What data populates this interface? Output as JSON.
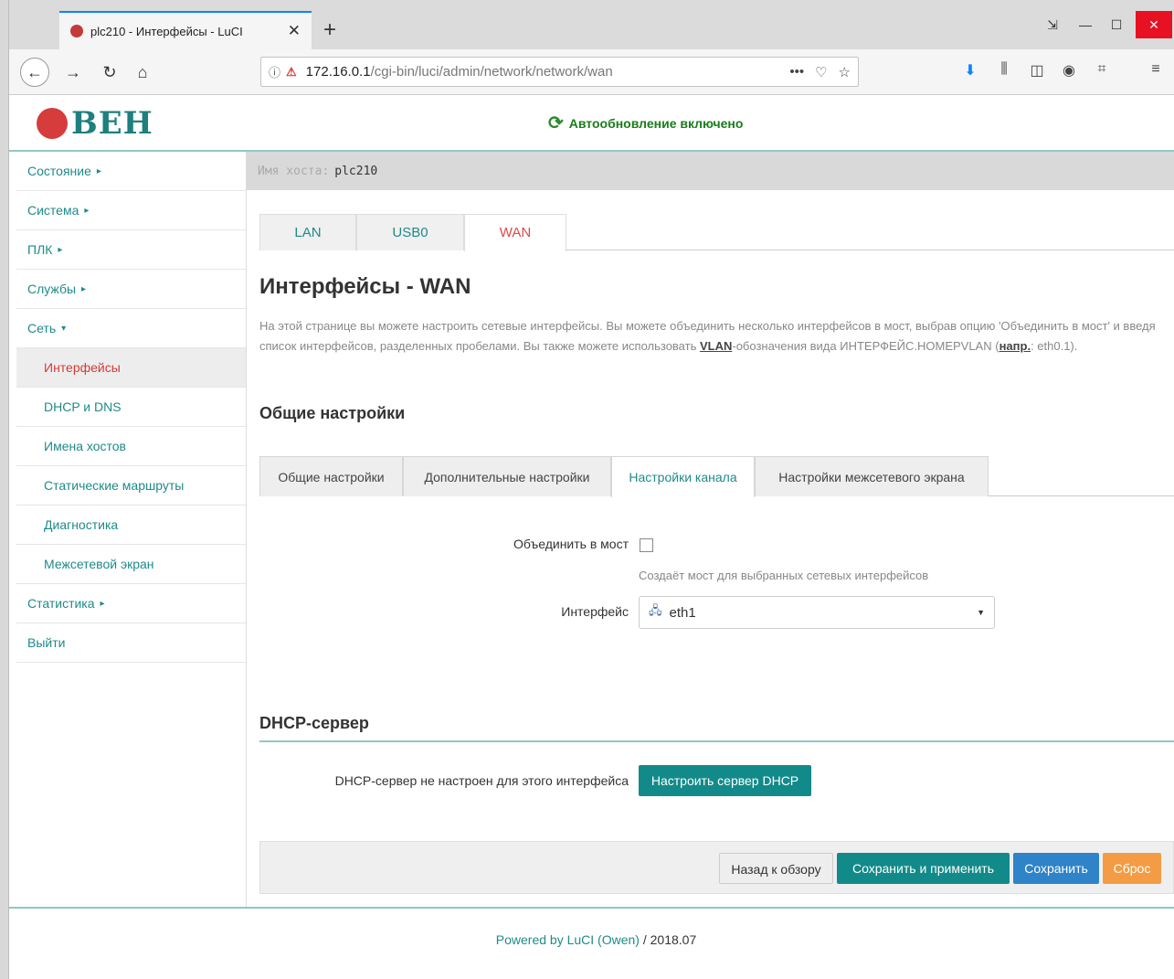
{
  "browser": {
    "tab_title": "plc210 - Интерфейсы - LuCI",
    "tab_close": "✕",
    "new_tab": "+",
    "url_host": "172.16.0.1",
    "url_path": "/cgi-bin/luci/admin/network/network/wan",
    "page_actions": "•••"
  },
  "header": {
    "logo_text": "ВЕН",
    "autorefresh": "Автообновление включено"
  },
  "sidebar": {
    "items": [
      {
        "label": "Состояние",
        "caret": "▸"
      },
      {
        "label": "Система",
        "caret": "▸"
      },
      {
        "label": "ПЛК",
        "caret": "▸"
      },
      {
        "label": "Службы",
        "caret": "▸"
      },
      {
        "label": "Сеть",
        "caret": "▾"
      },
      {
        "label": "Интерфейсы"
      },
      {
        "label": "DHCP и DNS"
      },
      {
        "label": "Имена хостов"
      },
      {
        "label": "Статические маршруты"
      },
      {
        "label": "Диагностика"
      },
      {
        "label": "Межсетевой экран"
      },
      {
        "label": "Статистика",
        "caret": "▸"
      },
      {
        "label": "Выйти"
      }
    ]
  },
  "main": {
    "hostname_label": "Имя хоста:",
    "hostname_value": "plc210",
    "net_tabs": [
      "LAN",
      "USB0",
      "WAN"
    ],
    "title": "Интерфейсы - WAN",
    "desc_part1": "На этой странице вы можете настроить сетевые интерфейсы. Вы можете объединить несколько интерфейсов в мост, выбрав опцию 'Объединить в мост' и введя список интерфейсов, разделенных пробелами. Вы также можете использовать ",
    "desc_vlan": "VLAN",
    "desc_part2": "-обозначения вида ИНТЕРФЕЙС.НОМЕРVLAN (",
    "desc_eg": "напр.",
    "desc_part3": ": eth0.1).",
    "section_general": "Общие настройки",
    "settings_tabs": [
      "Общие настройки",
      "Дополнительные настройки",
      "Настройки канала",
      "Настройки межсетевого экрана"
    ],
    "bridge_label": "Объединить в мост",
    "bridge_hint": "Создаёт мост для выбранных сетевых интерфейсов",
    "interface_label": "Интерфейс",
    "interface_value": "eth1",
    "section_dhcp": "DHCP-сервер",
    "dhcp_status": "DHCP-сервер не настроен для этого интерфейса",
    "dhcp_button": "Настроить сервер DHCP",
    "back_button": "Назад к обзору",
    "save_apply_button": "Сохранить и применить",
    "save_button": "Сохранить",
    "reset_button": "Сброс"
  },
  "footer": {
    "powered": "Powered by LuCI (Owen)",
    "version": " / 2018.07"
  },
  "colors": {
    "accent": "#138a8a",
    "active_red": "#e04848",
    "save_blue": "#2f83c8",
    "reset_orange": "#f39c45"
  }
}
